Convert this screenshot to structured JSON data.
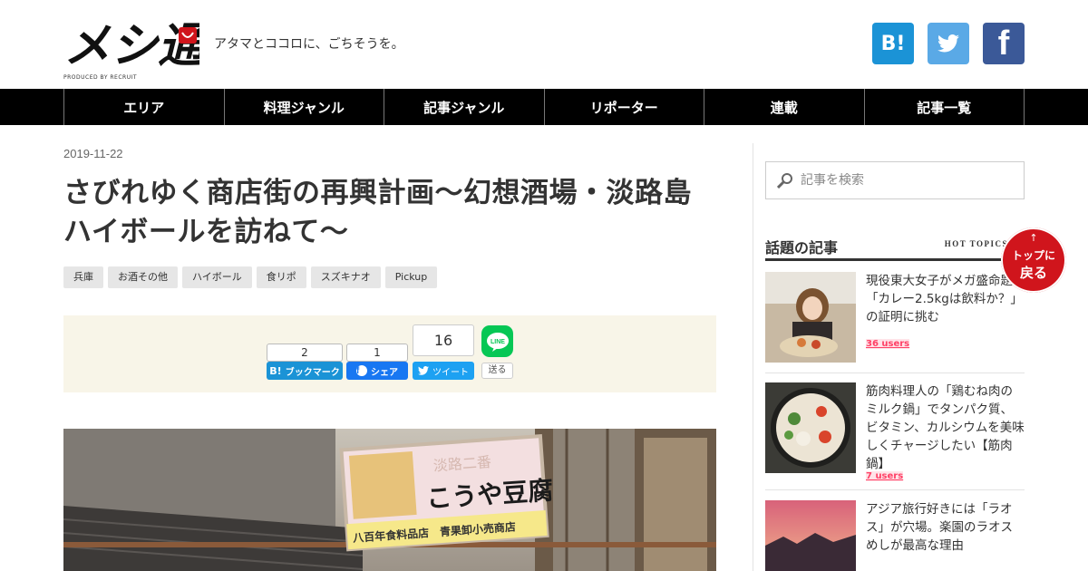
{
  "site": {
    "logo_text": "メシ通",
    "logo_credit": "PRODUCED BY RECRUIT",
    "tagline": "アタマとココロに、ごちそうを。",
    "social": [
      {
        "icon": "hatena-bookmark-icon",
        "label": "B!",
        "color": "#1b93d6"
      },
      {
        "icon": "twitter-icon",
        "label": "",
        "color": "#5aa9e6"
      },
      {
        "icon": "facebook-icon",
        "label": "f",
        "color": "#3b5998"
      }
    ]
  },
  "nav": {
    "items": [
      "エリア",
      "料理ジャンル",
      "記事ジャンル",
      "リポーター",
      "連載",
      "記事一覧"
    ]
  },
  "article": {
    "date": "2019-11-22",
    "title": "さびれゆく商店街の再興計画〜幻想酒場・淡路島ハイボールを訪ねて〜",
    "tags": [
      "兵庫",
      "お酒その他",
      "ハイボール",
      "食リポ",
      "スズキナオ",
      "Pickup"
    ],
    "share": {
      "hatena": {
        "count": "2",
        "label": "ブックマーク"
      },
      "facebook": {
        "count": "1",
        "label": "シェア"
      },
      "twitter": {
        "count": "16",
        "label": "ツイート"
      },
      "line": {
        "label": "送る"
      }
    },
    "hero": {
      "sign_main": "こうや豆腐",
      "sign_sub": "八百年食料品店　青果卸小売商店",
      "sign_top": "淡路二番"
    }
  },
  "sidebar": {
    "search_placeholder": "記事を検索",
    "popular_title": "話題の記事",
    "popular_sub": "HOT TOPICS",
    "articles": [
      {
        "title": "現役東大女子がメガ盛命題「カレー2.5kgは飲料か？」の証明に挑む",
        "users": "36 users"
      },
      {
        "title": "筋肉料理人の「鶏むね肉のミルク鍋」でタンパク質、ビタミン、カルシウムを美味しくチャージしたい【筋肉鍋】",
        "users": "7 users"
      },
      {
        "title": "アジア旅行好きには「ラオス」が穴場。楽園のラオスめしが最高な理由",
        "users": ""
      }
    ],
    "to_top": {
      "arrow": "↑",
      "line1": "トップに",
      "line2": "戻る"
    }
  },
  "colors": {
    "accent": "#d0151c",
    "nav_bg": "#000000",
    "share_bg": "#f8f5e8",
    "users": "#ff4166"
  }
}
